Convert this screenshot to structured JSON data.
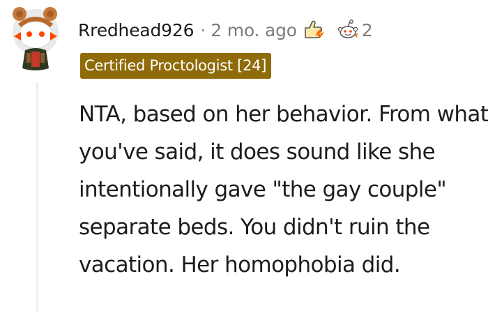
{
  "comment": {
    "author": "Rredhead926",
    "separator": "·",
    "age": "2 mo. ago",
    "awards": [
      {
        "icon": "helpful-hand-award-icon"
      },
      {
        "icon": "snoo-award-icon",
        "count": "2"
      }
    ],
    "flair": "Certified Proctologist [24]",
    "flair_color": "#8f6b09",
    "body": "NTA, based on her behavior. From what you've said, it does sound like she intentionally gave \"the gay couple\" separate beds. You didn't ruin the vacation. Her homophobia did."
  }
}
